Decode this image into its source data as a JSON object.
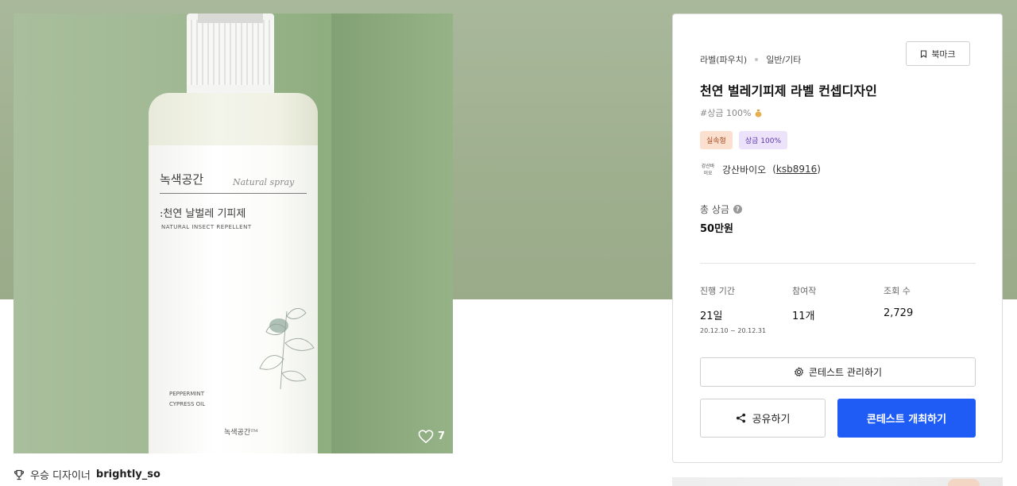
{
  "product": {
    "label_brand": "녹색공간",
    "label_script": "Natural spray",
    "label_name": ":천연 날벌레 기피제",
    "label_subtitle": "NATURAL INSECT REPELLENT",
    "label_ingredient_1": "PEPPERMINT",
    "label_ingredient_2": "CYPRESS OIL",
    "label_footer": "녹색공간ᵀᴹ",
    "like_count": "7"
  },
  "designer": {
    "prefix": "우승 디자이너",
    "name": "brightly_so"
  },
  "panel": {
    "bookmark_label": "북마크",
    "category_main": "라벨(파우치)",
    "category_sub": "일반/기타",
    "title": "천연 벌레기피제 라벨 컨셉디자인",
    "prize_tag": "#상금 100%",
    "badges": [
      "실속형",
      "상금 100%"
    ],
    "host_logo": "강산바이오",
    "host_name": "강산바이오",
    "host_id": "ksb8916",
    "total_prize_label": "총 상금",
    "total_prize_value": "50만원",
    "stats": [
      {
        "label": "진행 기간",
        "value": "21일",
        "sub": "20.12.10 ~ 20.12.31"
      },
      {
        "label": "참여작",
        "value": "11개",
        "sub": ""
      },
      {
        "label": "조회 수",
        "value": "2,729",
        "sub": ""
      }
    ],
    "manage_label": "콘테스트 관리하기",
    "share_label": "공유하기",
    "open_label": "콘테스트 개최하기"
  },
  "colors": {
    "primary": "#1f5cf5",
    "hero_background": "#9eaf8e",
    "badge_practical_bg": "#fbe0d0",
    "badge_prize_bg": "#ece3fb"
  },
  "icons": [
    "heart-icon",
    "trophy-icon",
    "bookmark-icon",
    "money-bag-icon",
    "help-icon",
    "gear-icon",
    "share-icon"
  ]
}
